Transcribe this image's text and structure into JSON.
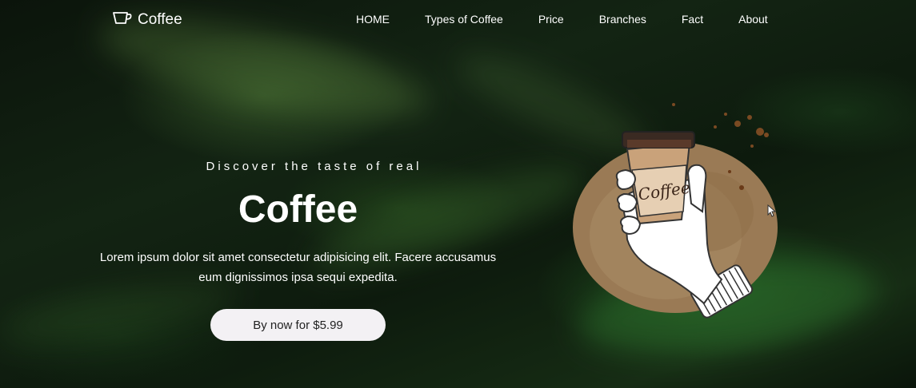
{
  "brand": {
    "name": "Coffee",
    "icon": "cup-icon"
  },
  "nav": [
    {
      "label": "HOME"
    },
    {
      "label": "Types of Coffee"
    },
    {
      "label": "Price"
    },
    {
      "label": "Branches"
    },
    {
      "label": "Fact"
    },
    {
      "label": "About"
    }
  ],
  "hero": {
    "tagline": "Discover the taste of real",
    "title": "Coffee",
    "description": "Lorem ipsum dolor sit amet consectetur adipisicing elit. Facere accusamus eum dignissimos ipsa sequi expedita.",
    "button_label": "By now for $5.99",
    "cup_text": "Coffee"
  },
  "colors": {
    "background": "#0d1a0d",
    "button_bg": "#f3f1f4",
    "text": "#ffffff",
    "splash": "#9a7a55"
  }
}
